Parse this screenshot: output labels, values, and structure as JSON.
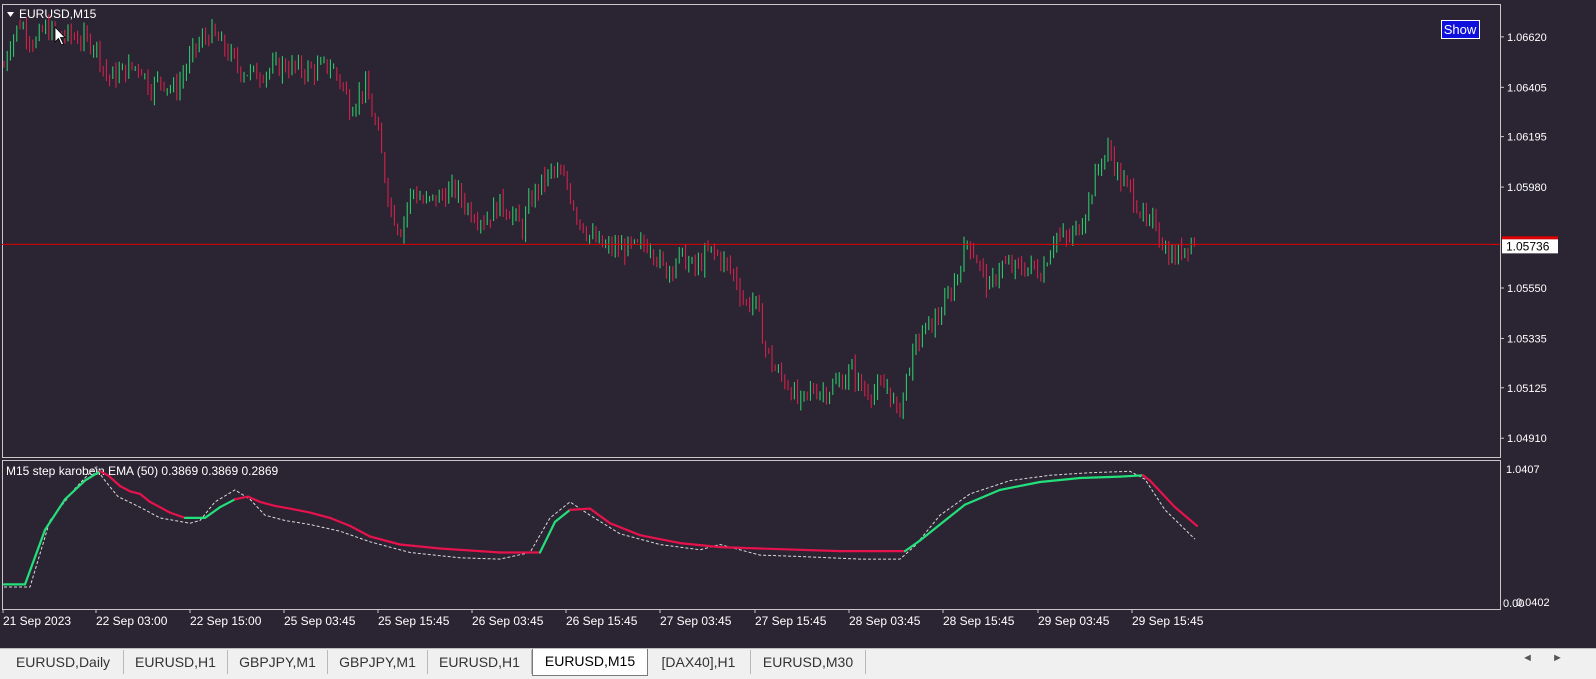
{
  "window": {
    "title": "EURUSD,M15",
    "show_button": "Show"
  },
  "colors": {
    "background": "#2b2533",
    "bull": "#2bd66e",
    "bear": "#e0204d",
    "price_line": "#e00000",
    "ema_up": "#22e07a",
    "ema_down": "#e6124c",
    "band": "#d9d9d9"
  },
  "chart_data": [
    {
      "type": "candlestick",
      "title": "EURUSD,M15",
      "current_price": 1.05736,
      "current_price_label": "1.05736",
      "y_ticks": [
        "1.06620",
        "1.06405",
        "1.06195",
        "1.05980",
        "1.05550",
        "1.05335",
        "1.05125",
        "1.04910"
      ],
      "x_ticks": [
        "21 Sep 2023",
        "22 Sep 03:00",
        "22 Sep 15:00",
        "25 Sep 03:45",
        "25 Sep 15:45",
        "26 Sep 03:45",
        "26 Sep 15:45",
        "27 Sep 03:45",
        "27 Sep 15:45",
        "28 Sep 03:45",
        "28 Sep 15:45",
        "29 Sep 03:45",
        "29 Sep 15:45"
      ],
      "ylim": [
        1.0483,
        1.0676
      ],
      "close_path": [
        [
          0,
          1.0641
        ],
        [
          8,
          1.0658
        ],
        [
          20,
          1.0668
        ],
        [
          35,
          1.0659
        ],
        [
          45,
          1.0666
        ],
        [
          55,
          1.0663
        ],
        [
          75,
          1.0662
        ],
        [
          95,
          1.0659
        ],
        [
          108,
          1.0644
        ],
        [
          125,
          1.0648
        ],
        [
          140,
          1.065
        ],
        [
          150,
          1.064
        ],
        [
          160,
          1.0644
        ],
        [
          175,
          1.0639
        ],
        [
          195,
          1.0657
        ],
        [
          210,
          1.0664
        ],
        [
          225,
          1.0657
        ],
        [
          240,
          1.0648
        ],
        [
          255,
          1.0646
        ],
        [
          270,
          1.0648
        ],
        [
          285,
          1.065
        ],
        [
          300,
          1.0648
        ],
        [
          315,
          1.0648
        ],
        [
          330,
          1.065
        ],
        [
          342,
          1.0642
        ],
        [
          350,
          1.0632
        ],
        [
          365,
          1.0641
        ],
        [
          378,
          1.062
        ],
        [
          390,
          1.059
        ],
        [
          400,
          1.0579
        ],
        [
          412,
          1.0597
        ],
        [
          425,
          1.0591
        ],
        [
          440,
          1.0594
        ],
        [
          455,
          1.0597
        ],
        [
          470,
          1.0588
        ],
        [
          485,
          1.0584
        ],
        [
          500,
          1.0591
        ],
        [
          512,
          1.0587
        ],
        [
          522,
          1.058
        ],
        [
          530,
          1.0592
        ],
        [
          540,
          1.0599
        ],
        [
          553,
          1.0605
        ],
        [
          566,
          1.06
        ],
        [
          578,
          1.0585
        ],
        [
          590,
          1.0577
        ],
        [
          605,
          1.0572
        ],
        [
          620,
          1.0572
        ],
        [
          635,
          1.0572
        ],
        [
          650,
          1.0574
        ],
        [
          665,
          1.0562
        ],
        [
          680,
          1.0569
        ],
        [
          695,
          1.0563
        ],
        [
          710,
          1.0571
        ],
        [
          720,
          1.0568
        ],
        [
          735,
          1.056
        ],
        [
          745,
          1.0548
        ],
        [
          755,
          1.055
        ],
        [
          765,
          1.053
        ],
        [
          775,
          1.052
        ],
        [
          790,
          1.0513
        ],
        [
          800,
          1.0505
        ],
        [
          812,
          1.0512
        ],
        [
          825,
          1.0511
        ],
        [
          840,
          1.0515
        ],
        [
          852,
          1.052
        ],
        [
          862,
          1.0512
        ],
        [
          875,
          1.0511
        ],
        [
          888,
          1.0513
        ],
        [
          898,
          1.05
        ],
        [
          908,
          1.052
        ],
        [
          920,
          1.0535
        ],
        [
          935,
          1.0541
        ],
        [
          945,
          1.0548
        ],
        [
          955,
          1.0558
        ],
        [
          968,
          1.0576
        ],
        [
          978,
          1.0566
        ],
        [
          990,
          1.0554
        ],
        [
          1000,
          1.0565
        ],
        [
          1015,
          1.0563
        ],
        [
          1030,
          1.0564
        ],
        [
          1042,
          1.0562
        ],
        [
          1055,
          1.0578
        ],
        [
          1068,
          1.0575
        ],
        [
          1080,
          1.0582
        ],
        [
          1090,
          1.0594
        ],
        [
          1100,
          1.0609
        ],
        [
          1110,
          1.0614
        ],
        [
          1120,
          1.0601
        ],
        [
          1130,
          1.0597
        ],
        [
          1140,
          1.0588
        ],
        [
          1148,
          1.058
        ],
        [
          1155,
          1.0584
        ],
        [
          1165,
          1.0571
        ],
        [
          1175,
          1.0568
        ],
        [
          1185,
          1.0573
        ],
        [
          1195,
          1.0576
        ]
      ]
    },
    {
      "type": "line",
      "title": "M15 step karobein EMA (50) 0.3869 0.3869 0.2869",
      "y_ticks": [
        "1.0407",
        "0.0402"
      ],
      "y_corner_label": "0.00",
      "ema_path": [
        [
          4,
          0.14
        ],
        [
          25,
          0.14
        ],
        [
          45,
          0.55
        ],
        [
          65,
          0.78
        ],
        [
          85,
          0.92
        ],
        [
          100,
          0.99
        ],
        [
          108,
          0.96
        ],
        [
          120,
          0.88
        ],
        [
          130,
          0.84
        ],
        [
          140,
          0.82
        ],
        [
          150,
          0.76
        ],
        [
          160,
          0.72
        ],
        [
          170,
          0.68
        ],
        [
          185,
          0.64
        ],
        [
          205,
          0.64
        ],
        [
          220,
          0.72
        ],
        [
          235,
          0.78
        ],
        [
          248,
          0.8
        ],
        [
          260,
          0.76
        ],
        [
          275,
          0.73
        ],
        [
          290,
          0.71
        ],
        [
          310,
          0.68
        ],
        [
          330,
          0.64
        ],
        [
          350,
          0.58
        ],
        [
          370,
          0.5
        ],
        [
          400,
          0.44
        ],
        [
          440,
          0.41
        ],
        [
          480,
          0.39
        ],
        [
          500,
          0.38
        ],
        [
          540,
          0.38
        ],
        [
          555,
          0.61
        ],
        [
          570,
          0.7
        ],
        [
          590,
          0.71
        ],
        [
          610,
          0.6
        ],
        [
          640,
          0.51
        ],
        [
          680,
          0.45
        ],
        [
          720,
          0.42
        ],
        [
          760,
          0.41
        ],
        [
          800,
          0.4
        ],
        [
          840,
          0.39
        ],
        [
          880,
          0.39
        ],
        [
          905,
          0.39
        ],
        [
          920,
          0.47
        ],
        [
          945,
          0.62
        ],
        [
          965,
          0.74
        ],
        [
          1000,
          0.85
        ],
        [
          1040,
          0.91
        ],
        [
          1080,
          0.94
        ],
        [
          1120,
          0.95
        ],
        [
          1143,
          0.96
        ],
        [
          1150,
          0.92
        ],
        [
          1175,
          0.72
        ],
        [
          1197,
          0.58
        ]
      ],
      "ema_up_segments": [
        [
          4,
          100
        ],
        [
          185,
          240
        ],
        [
          540,
          575
        ],
        [
          905,
          1143
        ]
      ],
      "band_path": [
        [
          4,
          0.12
        ],
        [
          30,
          0.12
        ],
        [
          50,
          0.62
        ],
        [
          75,
          0.86
        ],
        [
          95,
          1.02
        ],
        [
          105,
          0.92
        ],
        [
          118,
          0.8
        ],
        [
          140,
          0.72
        ],
        [
          160,
          0.64
        ],
        [
          190,
          0.6
        ],
        [
          200,
          0.62
        ],
        [
          215,
          0.76
        ],
        [
          235,
          0.85
        ],
        [
          250,
          0.78
        ],
        [
          265,
          0.66
        ],
        [
          285,
          0.62
        ],
        [
          310,
          0.59
        ],
        [
          340,
          0.54
        ],
        [
          370,
          0.46
        ],
        [
          410,
          0.38
        ],
        [
          460,
          0.34
        ],
        [
          500,
          0.33
        ],
        [
          530,
          0.38
        ],
        [
          550,
          0.64
        ],
        [
          570,
          0.76
        ],
        [
          590,
          0.66
        ],
        [
          620,
          0.52
        ],
        [
          660,
          0.44
        ],
        [
          700,
          0.4
        ],
        [
          720,
          0.44
        ],
        [
          760,
          0.36
        ],
        [
          800,
          0.35
        ],
        [
          860,
          0.33
        ],
        [
          900,
          0.33
        ],
        [
          915,
          0.43
        ],
        [
          940,
          0.66
        ],
        [
          970,
          0.82
        ],
        [
          1010,
          0.92
        ],
        [
          1050,
          0.96
        ],
        [
          1090,
          0.98
        ],
        [
          1130,
          0.99
        ],
        [
          1145,
          0.93
        ],
        [
          1165,
          0.7
        ],
        [
          1195,
          0.48
        ]
      ]
    }
  ],
  "tabs": [
    {
      "label": "EURUSD,Daily",
      "active": false
    },
    {
      "label": "EURUSD,H1",
      "active": false
    },
    {
      "label": "GBPJPY,M1",
      "active": false
    },
    {
      "label": "GBPJPY,M1",
      "active": false
    },
    {
      "label": "EURUSD,H1",
      "active": false
    },
    {
      "label": "EURUSD,M15",
      "active": true
    },
    {
      "label": "[DAX40],H1",
      "active": false
    },
    {
      "label": "EURUSD,M30",
      "active": false
    }
  ],
  "nav": {
    "left": "◄",
    "right": "►"
  }
}
